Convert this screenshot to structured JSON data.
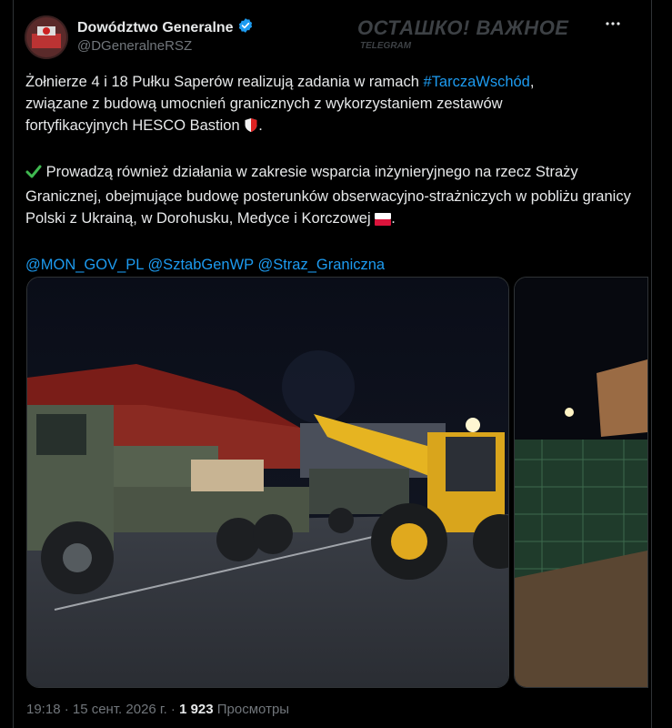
{
  "author": {
    "display_name": "Dowództwo Generalne",
    "handle": "@DGeneralneRSZ"
  },
  "watermark": {
    "title": "ОСТАШКО! ВАЖНОЕ",
    "subtitle": "TELEGRAM"
  },
  "tweet": {
    "p1_text": "Żołnierze 4 i 18 Pułku Saperów realizują zadania w ramach ",
    "p1_hashtag": "#TarczaWschód",
    "p1_tail": ",",
    "p1_line2": "związane z budową umocnień granicznych z wykorzystaniem zestawów",
    "p1_line3": "fortyfikacyjnych HESCO Bastion",
    "p1_end": ".",
    "p2_text": "Prowadzą również działania w zakresie wsparcia inżynieryjnego na rzecz Straży Granicznej, obejmujące budowę posterunków obserwacyjno-strażniczych w pobliżu granicy Polski z Ukrainą, w Dorohusku, Medyce i Korczowej",
    "p2_end": ".",
    "mentions": [
      "@MON_GOV_PL",
      "@SztabGenWP",
      "@Straz_Graniczna"
    ]
  },
  "footer": {
    "time": "19:18 · 15 сент. 2026 г. · ",
    "views_count": "1 923",
    "views_label": " Просмотры"
  },
  "colors": {
    "link": "#1d9bf0",
    "verified": "#1d9bf0",
    "background": "#000000"
  },
  "icons": [
    "verified-badge-icon",
    "more-options-icon",
    "shield-emoji",
    "check-mark-emoji",
    "poland-flag-emoji"
  ]
}
